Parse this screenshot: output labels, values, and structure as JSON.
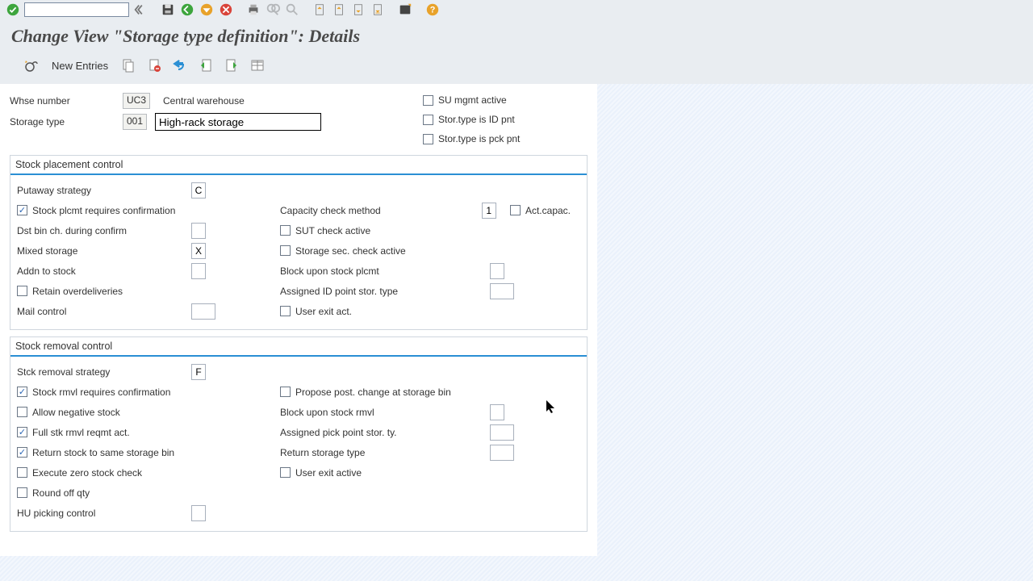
{
  "page_title": "Change View \"Storage type definition\": Details",
  "app_toolbar": {
    "new_entries": "New Entries"
  },
  "header": {
    "whse_lbl": "Whse number",
    "whse_code": "UC3",
    "whse_desc": "Central warehouse",
    "stype_lbl": "Storage type",
    "stype_code": "001",
    "stype_desc": "High-rack storage",
    "su_mgmt": "SU mgmt active",
    "id_pnt": "Stor.type is ID pnt",
    "pck_pnt": "Stor.type is pck pnt"
  },
  "group1": {
    "title": "Stock placement control",
    "putaway_lbl": "Putaway strategy",
    "putaway_val": "C",
    "plcmt_confirm": "Stock plcmt requires confirmation",
    "dst_bin": "Dst bin ch. during confirm",
    "mixed_lbl": "Mixed storage",
    "mixed_val": "X",
    "addn_lbl": "Addn to stock",
    "retain": "Retain overdeliveries",
    "mail_lbl": "Mail control",
    "capchk_lbl": "Capacity check method",
    "capchk_val": "1",
    "act_capac": "Act.capac.",
    "sut": "SUT check active",
    "sec": "Storage sec. check active",
    "block_lbl": "Block upon stock plcmt",
    "assigned_lbl": "Assigned ID point stor. type",
    "user_exit": "User exit act."
  },
  "group2": {
    "title": "Stock removal control",
    "rmvl_strat_lbl": "Stck removal strategy",
    "rmvl_strat_val": "F",
    "rmvl_confirm": "Stock rmvl requires confirmation",
    "allow_neg": "Allow negative stock",
    "full_stk": "Full stk rmvl reqmt act.",
    "return_same": "Return stock to same storage bin",
    "exec_zero": "Execute zero stock check",
    "round_off": "Round off qty",
    "hu_lbl": "HU picking control",
    "propose": "Propose post. change at storage bin",
    "block_rmvl_lbl": "Block upon stock rmvl",
    "assigned_pick_lbl": "Assigned pick point stor. ty.",
    "return_type_lbl": "Return storage type",
    "user_exit2": "User exit active"
  }
}
